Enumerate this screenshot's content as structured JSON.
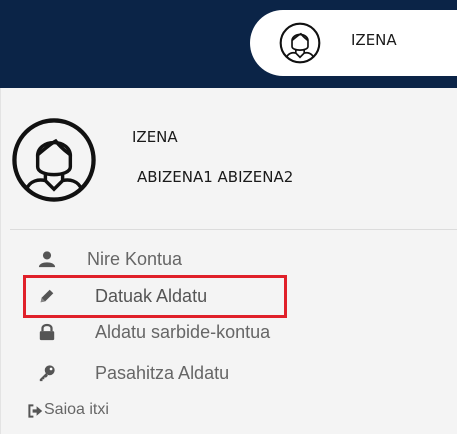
{
  "header": {
    "user_name": "IZENA",
    "avatar_icon": "user-avatar-icon",
    "background_color": "#0b2447"
  },
  "profile": {
    "first_name": "IZENA",
    "last_names": "ABIZENA1 ABIZENA2",
    "avatar_icon": "user-avatar-icon"
  },
  "menu": {
    "items": [
      {
        "label": "Nire Kontua",
        "icon": "user-icon"
      },
      {
        "label": "Datuak Aldatu",
        "icon": "pencil-icon",
        "highlighted": true
      },
      {
        "label": "Aldatu sarbide-kontua",
        "icon": "lock-icon"
      },
      {
        "label": "Pasahitza Aldatu",
        "icon": "key-icon"
      },
      {
        "label": "Saioa itxi",
        "icon": "sign-out-icon"
      }
    ]
  },
  "highlight_color": "#e0202a"
}
